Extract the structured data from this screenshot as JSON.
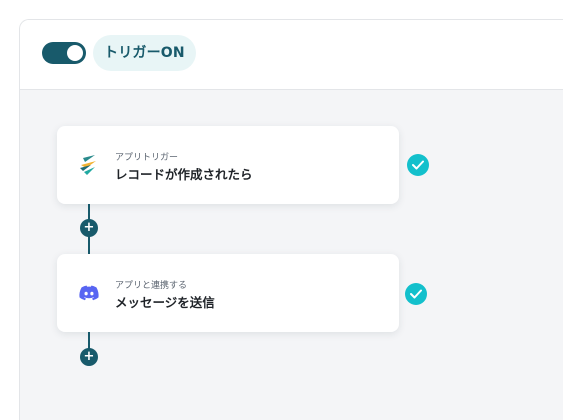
{
  "header": {
    "toggle_state": "on",
    "trigger_label": "トリガーON"
  },
  "steps": [
    {
      "category": "アプリトリガー",
      "title": "レコードが作成されたら",
      "icon": "kintone-style-app-icon",
      "status": "complete"
    },
    {
      "category": "アプリと連携する",
      "title": "メッセージを送信",
      "icon": "discord-icon",
      "status": "complete"
    }
  ],
  "add_step_glyph": "+",
  "colors": {
    "accent": "#185a6b",
    "check": "#13c0cc",
    "pill_bg": "#e8f5f6",
    "canvas_bg": "#f4f5f7",
    "discord": "#5865f2"
  }
}
